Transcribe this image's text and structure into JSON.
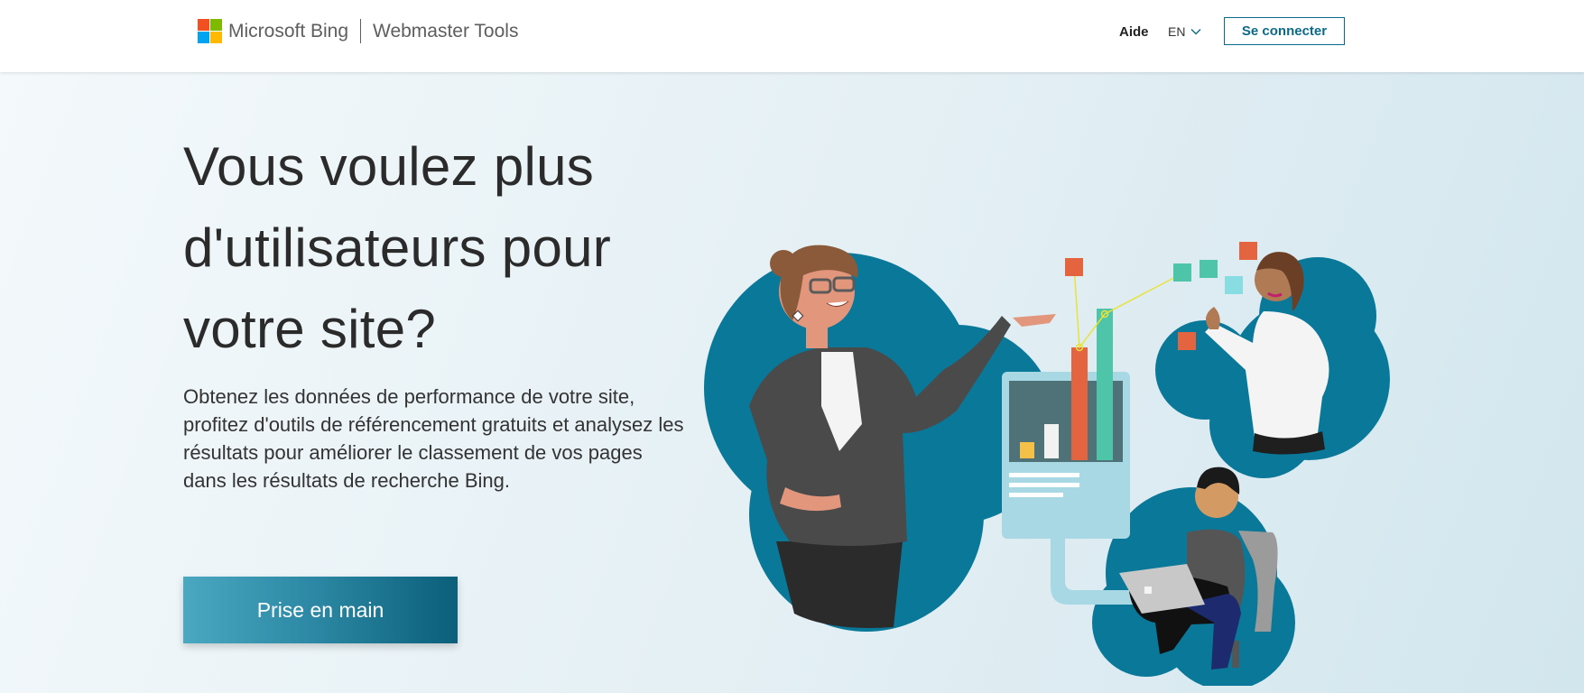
{
  "header": {
    "brand_primary": "Microsoft Bing",
    "brand_secondary": "Webmaster Tools",
    "logo_colors": [
      "#f25022",
      "#7fba00",
      "#00a4ef",
      "#ffb900"
    ],
    "help_label": "Aide",
    "language": {
      "selected": "EN",
      "icon": "chevron-down-icon"
    },
    "signin_label": "Se connecter"
  },
  "hero": {
    "title": "Vous voulez plus d'utilisateurs pour votre site?",
    "description": "Obtenez les données de performance de votre site, profitez d'outils de référencement gratuits et analysez les résultats pour améliorer le classement de vos pages dans les résultats de recherche Bing.",
    "cta_label": "Prise en main",
    "illustration": "people-analytics-illustration"
  },
  "colors": {
    "accent": "#0b6a88",
    "blob": "#0a7899",
    "cta_start": "#4aa8c1",
    "cta_end": "#0b5f7a"
  }
}
